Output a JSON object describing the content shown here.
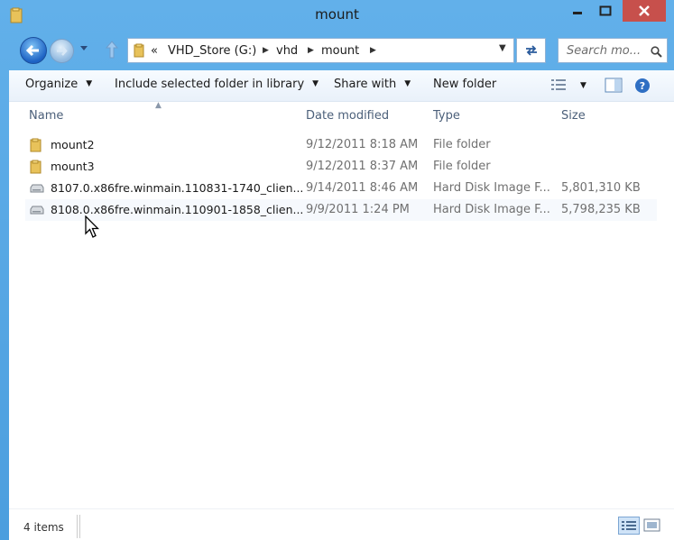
{
  "window": {
    "title": "mount",
    "accent": "#4b9ede",
    "close_color": "#c7504c"
  },
  "navigation": {
    "breadcrumb_overflow": "«",
    "breadcrumbs": [
      "VHD_Store (G:)",
      "vhd",
      "mount"
    ],
    "search_placeholder": "Search mo..."
  },
  "toolbar": {
    "organize": "Organize",
    "include_in_library": "Include selected folder in library",
    "share_with": "Share with",
    "new_folder": "New folder"
  },
  "columns": {
    "name": "Name",
    "date_modified": "Date modified",
    "type": "Type",
    "size": "Size"
  },
  "files": [
    {
      "name": "mount2",
      "date": "9/12/2011 8:18 AM",
      "type": "File folder",
      "size": "",
      "icon": "folder-icon"
    },
    {
      "name": "mount3",
      "date": "9/12/2011 8:37 AM",
      "type": "File folder",
      "size": "",
      "icon": "folder-icon"
    },
    {
      "name": "8107.0.x86fre.winmain.110831-1740_clien...",
      "date": "9/14/2011 8:46 AM",
      "type": "Hard Disk Image F...",
      "size": "5,801,310 KB",
      "icon": "disk-image-icon"
    },
    {
      "name": "8108.0.x86fre.winmain.110901-1858_clien...",
      "date": "9/9/2011 1:24 PM",
      "type": "Hard Disk Image F...",
      "size": "5,798,235 KB",
      "icon": "disk-image-icon"
    }
  ],
  "status": {
    "item_count": "4 items"
  }
}
